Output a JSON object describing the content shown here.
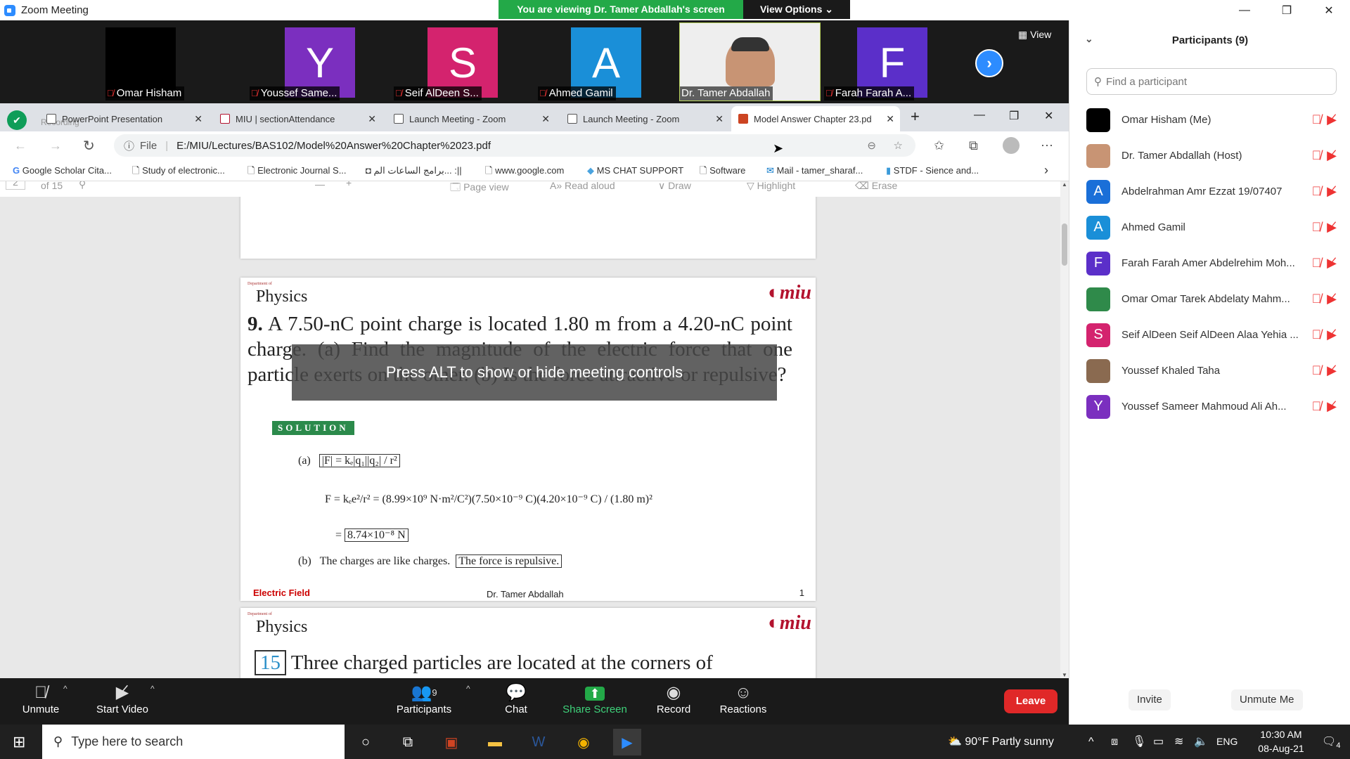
{
  "window": {
    "title": "Zoom Meeting"
  },
  "banner": {
    "message": "You are viewing Dr. Tamer Abdallah's screen",
    "options": "View Options ⌄"
  },
  "strip": {
    "view_label": "View",
    "tiles": [
      {
        "letter": "",
        "name": "Omar Hisham",
        "color": "#000000"
      },
      {
        "letter": "Y",
        "name": "Youssef Same...",
        "color": "#7b2fbf"
      },
      {
        "letter": "S",
        "name": "Seif AlDeen S...",
        "color": "#d4236e"
      },
      {
        "letter": "A",
        "name": "Ahmed Gamil",
        "color": "#1a8fd8"
      },
      {
        "letter": "",
        "name": "Dr. Tamer Abdallah",
        "color": "#eeeeee"
      },
      {
        "letter": "F",
        "name": "Farah Farah A...",
        "color": "#5b2fc9"
      }
    ]
  },
  "browser": {
    "recording": "Recording",
    "tabs": [
      {
        "label": "PowerPoint Presentation"
      },
      {
        "label": "MIU | sectionAttendance"
      },
      {
        "label": "Launch Meeting - Zoom"
      },
      {
        "label": "Launch Meeting - Zoom"
      },
      {
        "label": "Model Answer Chapter 23.pd"
      }
    ],
    "file_label": "File",
    "url": "E:/MIU/Lectures/BAS102/Model%20Answer%20Chapter%2023.pdf",
    "bookmarks": [
      "Google Scholar Cita...",
      "Study of electronic...",
      "Electronic Journal S...",
      "برامج الساعات الم... :||",
      "www.google.com",
      "MS CHAT SUPPORT",
      "Software",
      "Mail - tamer_sharaf...",
      "STDF - Sience and..."
    ],
    "pdf_toolbar": {
      "page_num": "2",
      "page_of": "of 15",
      "page_view": "Page view",
      "read_aloud": "Read aloud",
      "draw": "Draw",
      "highlight": "Highlight",
      "erase": "Erase"
    }
  },
  "pdf": {
    "dept": "Department of",
    "subject": "Physics",
    "logo": "miu",
    "question_num": "9.",
    "question": "A 7.50-nC point charge is located 1.80 m from a 4.20-nC point charge. (a) Find the magnitude of the electric force that one particle exerts on the other. (b) Is the force attractive or repulsive?",
    "solution": "SOLUTION",
    "eq_a_label": "(a)",
    "eq_a": "|F| = kₑ|q₁||q₂| / r²",
    "eq_b": "F = kₑe²/r² = (8.99×10⁹ N·m²/C²)(7.50×10⁻⁹ C)(4.20×10⁻⁹ C) / (1.80 m)²",
    "eq_result": "= 8.74×10⁻⁸ N",
    "result_box": "8.74×10⁻⁸ N",
    "part_b_label": "(b)",
    "part_b_text": "The charges are like charges.",
    "part_b_box": "The force is repulsive.",
    "footer_left": "Electric Field",
    "footer_center": "Dr. Tamer Abdallah",
    "footer_right": "1",
    "next_question_num": "15",
    "next_question": "Three charged particles are located at the corners of"
  },
  "overlay": {
    "text": "Press ALT to show or hide meeting controls"
  },
  "participants": {
    "title": "Participants (9)",
    "search_placeholder": "Find a participant",
    "list": [
      {
        "name": "Omar Hisham (Me)",
        "initial": "",
        "color": "#000000"
      },
      {
        "name": "Dr. Tamer Abdallah (Host)",
        "initial": "",
        "color": "#c89474"
      },
      {
        "name": "Abdelrahman Amr Ezzat 19/07407",
        "initial": "A",
        "color": "#1a6fd8"
      },
      {
        "name": "Ahmed Gamil",
        "initial": "A",
        "color": "#1a8fd8"
      },
      {
        "name": "Farah Farah Amer Abdelrehim Moh...",
        "initial": "F",
        "color": "#5b2fc9"
      },
      {
        "name": "Omar Omar Tarek Abdelaty Mahm...",
        "initial": "",
        "color": "#2f8a4a"
      },
      {
        "name": "Seif AlDeen Seif AlDeen Alaa Yehia ...",
        "initial": "S",
        "color": "#d4236e"
      },
      {
        "name": "Youssef Khaled Taha",
        "initial": "",
        "color": "#8a6a50"
      },
      {
        "name": "Youssef Sameer Mahmoud Ali Ah...",
        "initial": "Y",
        "color": "#7b2fbf"
      }
    ],
    "invite": "Invite",
    "unmute_me": "Unmute Me"
  },
  "toolbar": {
    "unmute": "Unmute",
    "start_video": "Start Video",
    "participants": "Participants",
    "participants_count": "9",
    "chat": "Chat",
    "share_screen": "Share Screen",
    "record": "Record",
    "reactions": "Reactions",
    "leave": "Leave"
  },
  "taskbar": {
    "search": "Type here to search",
    "weather": "90°F  Partly sunny",
    "lang": "ENG",
    "time": "10:30 AM",
    "date": "08-Aug-21",
    "notifications": "4"
  }
}
